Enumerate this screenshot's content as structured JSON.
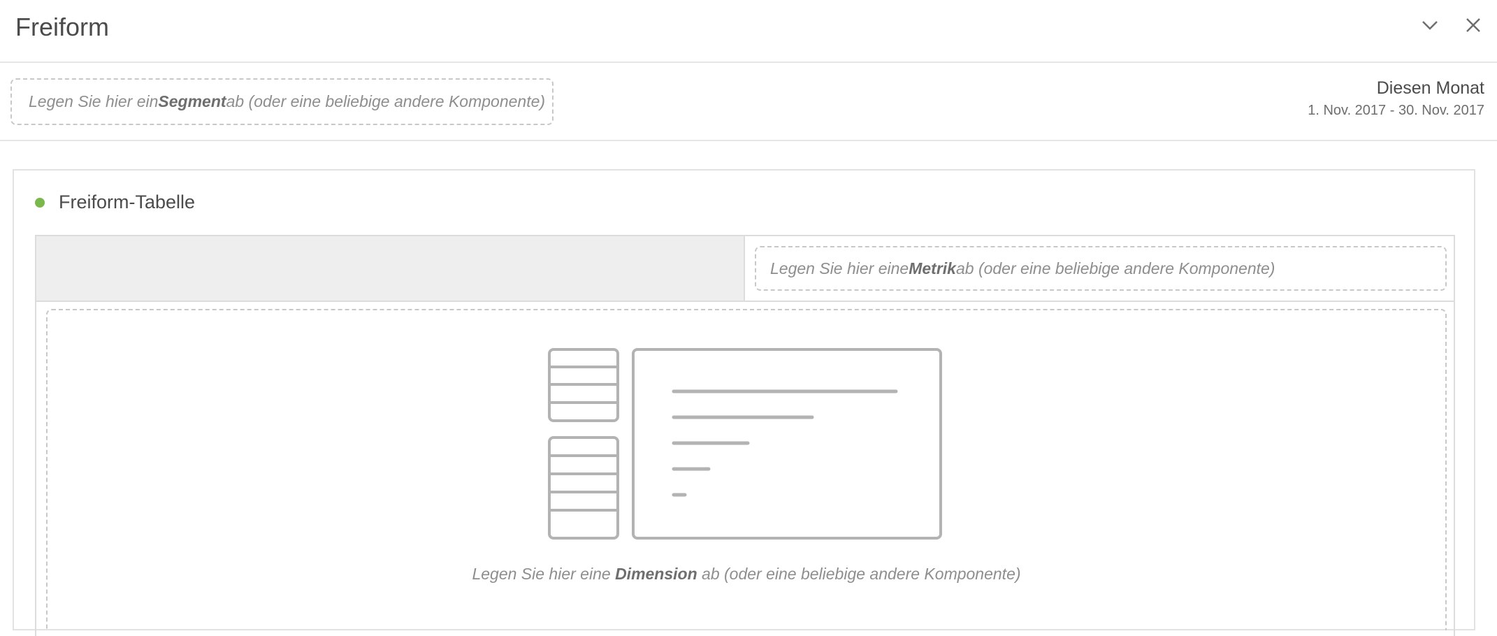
{
  "header": {
    "title": "Freiform",
    "collapse_icon": "chevron-down-icon",
    "close_icon": "close-icon"
  },
  "segment_bar": {
    "drop_prefix": "Legen Sie hier ein ",
    "drop_strong": "Segment",
    "drop_suffix": " ab (oder eine beliebige andere Komponente)"
  },
  "date_range": {
    "label": "Diesen Monat",
    "dates": "1. Nov. 2017 - 30. Nov. 2017"
  },
  "panel": {
    "status_color": "#7bb84c",
    "title": "Freiform-Tabelle",
    "metric_drop": {
      "prefix": "Legen Sie hier eine ",
      "strong": "Metrik",
      "suffix": " ab (oder eine beliebige andere Komponente)"
    },
    "dimension_drop": {
      "prefix": "Legen Sie hier eine ",
      "strong": "Dimension",
      "suffix": " ab (oder eine beliebige andere Komponente)",
      "illustration_icon": "freeform-table-placeholder-icon"
    }
  }
}
